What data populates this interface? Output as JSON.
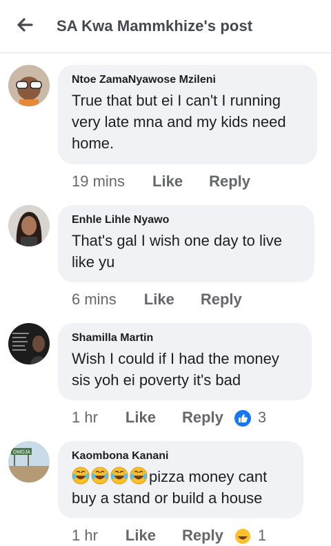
{
  "header": {
    "title": "SA Kwa Mammkhize's post"
  },
  "comments": [
    {
      "author": "Ntoe ZamaNyawose Mzileni",
      "text": "True that but ei I can't I running very late mna and my kids need home.",
      "time": "19 mins",
      "like": "Like",
      "reply": "Reply"
    },
    {
      "author": "Enhle Lihle Nyawo",
      "text": "That's gal I wish one day to live like yu",
      "time": "6 mins",
      "like": "Like",
      "reply": "Reply"
    },
    {
      "author": "Shamilla Martin",
      "text": "Wish I could if I had the money sis yoh ei poverty it's bad",
      "time": "1 hr",
      "like": "Like",
      "reply": "Reply",
      "reaction_icon": "like-reaction-icon",
      "reaction_count": "3"
    },
    {
      "author": "Kaombona Kanani",
      "emoji": "laughing-tears-emoji",
      "text": "pizza money cant buy a stand or build a house",
      "time": "1 hr",
      "like": "Like",
      "reply": "Reply",
      "reaction_count": "1"
    }
  ],
  "colors": {
    "bubble": "#f0f2f5",
    "secondary_text": "#65676b",
    "like_blue": "#1877f2"
  }
}
